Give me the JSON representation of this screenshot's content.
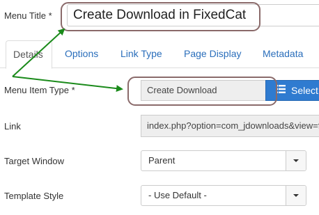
{
  "menu_title": {
    "label": "Menu Title *",
    "value": "Create Download in FixedCat"
  },
  "tabs": [
    {
      "label": "Details",
      "active": true
    },
    {
      "label": "Options",
      "active": false
    },
    {
      "label": "Link Type",
      "active": false
    },
    {
      "label": "Page Display",
      "active": false
    },
    {
      "label": "Metadata",
      "active": false
    }
  ],
  "menu_item_type": {
    "label": "Menu Item Type *",
    "value": "Create Download",
    "select_button": "Select",
    "select_icon": "list-icon"
  },
  "link": {
    "label": "Link",
    "value": "index.php?option=com_jdownloads&view=form&layout=edit"
  },
  "target_window": {
    "label": "Target Window",
    "value": "Parent"
  },
  "template_style": {
    "label": "Template Style",
    "value": "- Use Default -"
  },
  "colors": {
    "tab_link": "#2a6ebb",
    "select_button_bg": "#2f7bd0",
    "annotation_border": "#8a6a6a",
    "annotation_arrow": "#1a8a1a",
    "readonly_bg": "#eeeeee"
  }
}
